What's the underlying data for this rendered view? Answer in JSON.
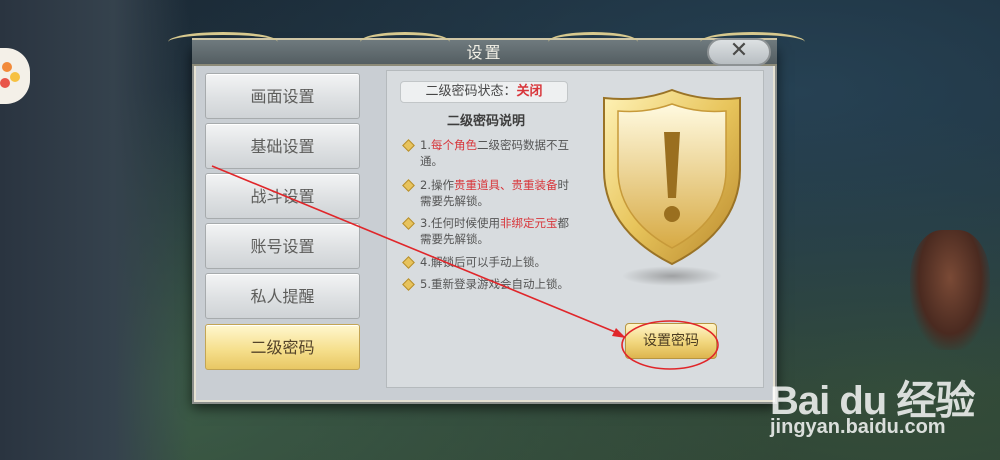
{
  "dialog": {
    "title": "设置",
    "close_icon": "close-icon"
  },
  "sidebar": {
    "items": [
      {
        "label": "画面设置",
        "active": false
      },
      {
        "label": "基础设置",
        "active": false
      },
      {
        "label": "战斗设置",
        "active": false
      },
      {
        "label": "账号设置",
        "active": false
      },
      {
        "label": "私人提醒",
        "active": false
      },
      {
        "label": "二级密码",
        "active": true
      }
    ]
  },
  "content": {
    "status_label": "二级密码状态：",
    "status_value": "关闭",
    "desc_title": "二级密码说明",
    "items": [
      {
        "pre": "1.",
        "red": "每个角色",
        "post": "二级密码数据不互通。"
      },
      {
        "pre": "2.操作",
        "red": "贵重道具、贵重装备",
        "post": "时需要先解锁。"
      },
      {
        "pre": "3.任何时候使用",
        "red": "非绑定元宝",
        "post": "都需要先解锁。"
      },
      {
        "pre": "4.解锁后可以手动上锁。",
        "red": "",
        "post": ""
      },
      {
        "pre": "5.重新登录游戏会自动上锁。",
        "red": "",
        "post": ""
      }
    ],
    "shield_icon": "warning-shield-icon",
    "set_password_button": "设置密码"
  },
  "colors": {
    "accent_gold": "#f1d67c",
    "status_red": "#d8353a",
    "annotation_red": "#e0262a"
  },
  "watermark": {
    "logo": "Bai du 经验",
    "url": "jingyan.baidu.com"
  }
}
